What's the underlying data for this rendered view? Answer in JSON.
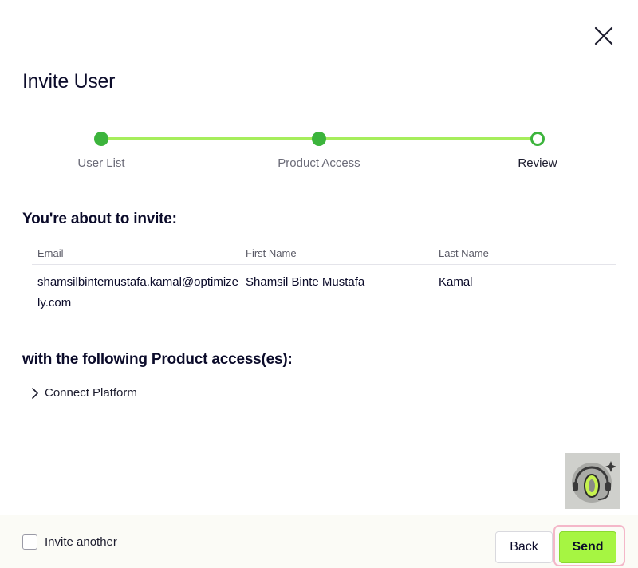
{
  "dialog": {
    "title": "Invite User",
    "close_icon": "close-icon"
  },
  "stepper": {
    "steps": [
      {
        "label": "User List",
        "state": "done"
      },
      {
        "label": "Product Access",
        "state": "done"
      },
      {
        "label": "Review",
        "state": "current"
      }
    ],
    "colors": {
      "done": "#3cb43c",
      "line": "#a6ee5c"
    }
  },
  "review": {
    "invite_heading": "You're about to invite:",
    "table": {
      "columns": [
        "Email",
        "First Name",
        "Last Name"
      ],
      "rows": [
        {
          "email": "shamsilbintemustafa.kamal@optimizely.com",
          "first_name": "Shamsil Binte Mustafa",
          "last_name": "Kamal"
        }
      ]
    },
    "access_heading": "with the following Product access(es):",
    "products": [
      {
        "label": "Connect Platform",
        "icon": "chevron-right-icon"
      }
    ]
  },
  "assistant": {
    "icon": "support-assistant-icon"
  },
  "footer": {
    "invite_another_label": "Invite another",
    "invite_another_checked": false,
    "back_label": "Back",
    "send_label": "Send"
  },
  "colors": {
    "accent": "#a6f542",
    "text": "#0b0b2a",
    "focus_ring": "#f4b7c9"
  }
}
